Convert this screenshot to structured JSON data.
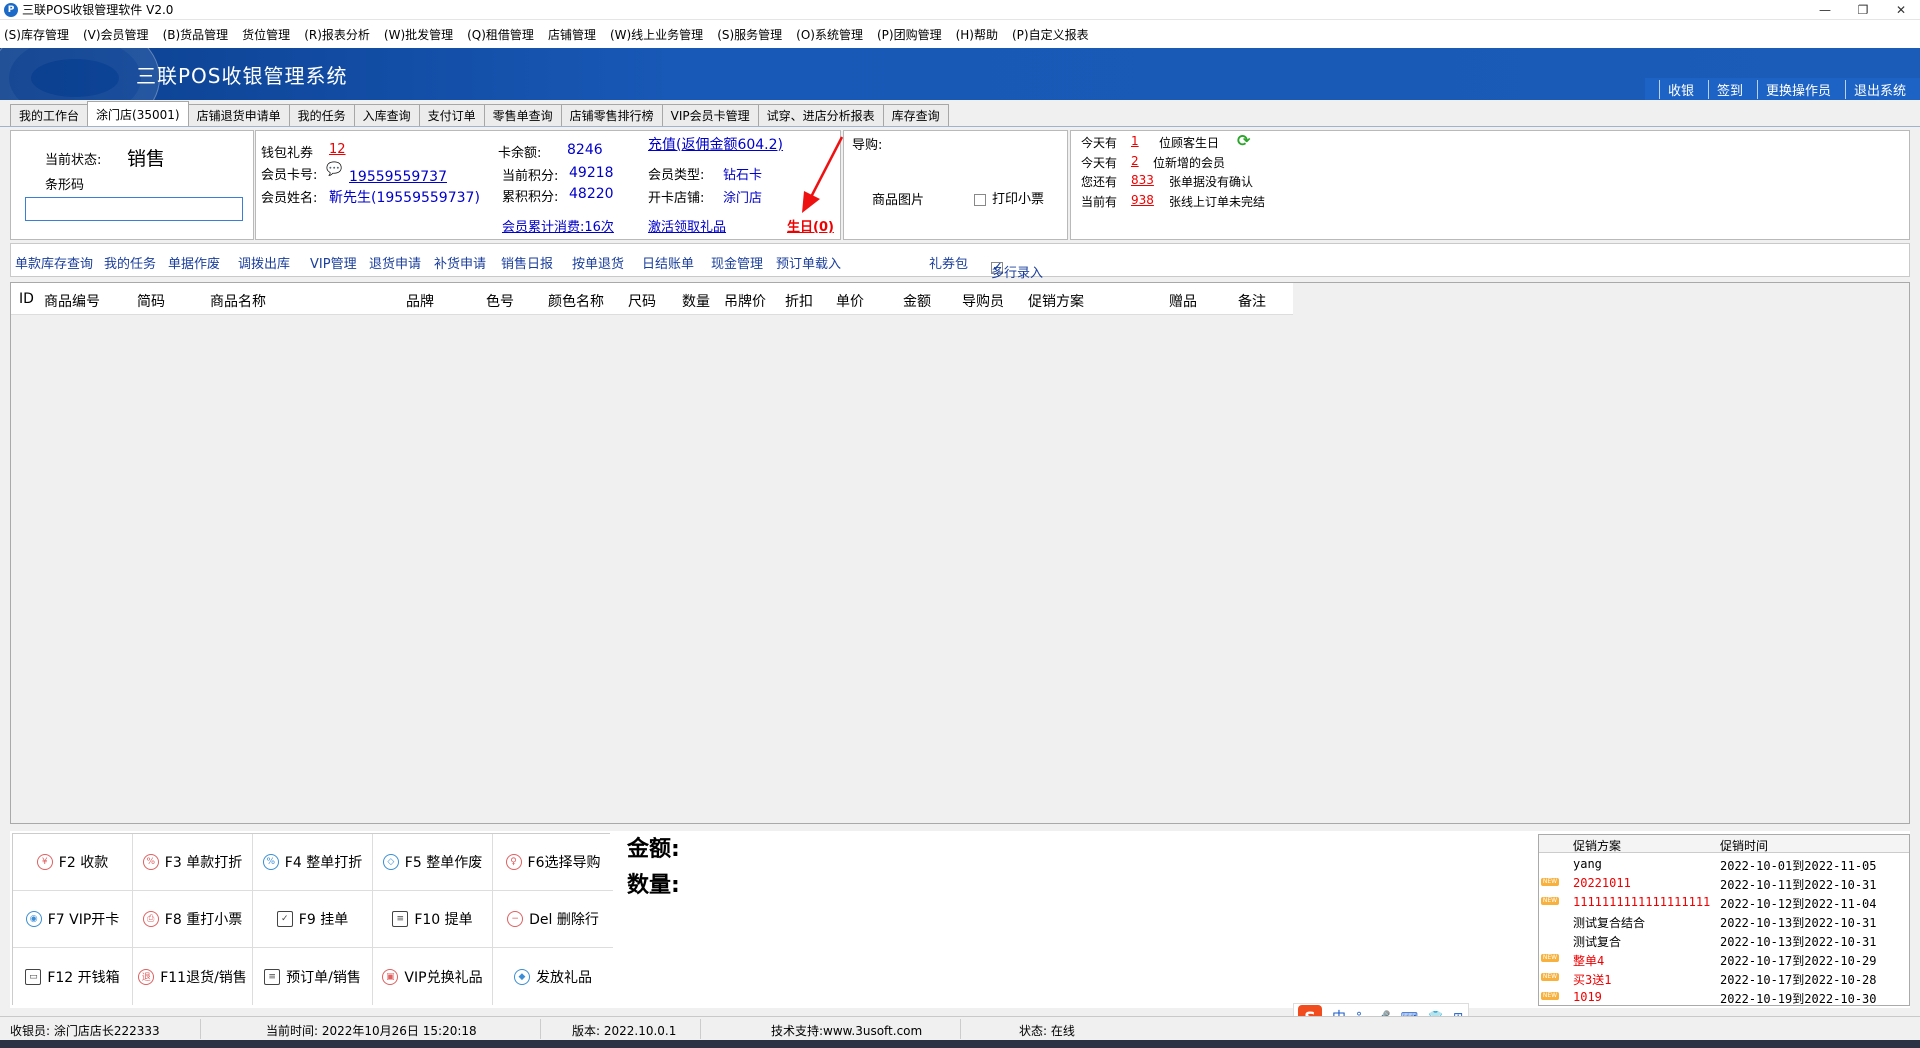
{
  "window": {
    "title": "三联POS收银管理软件 V2.0",
    "minimize": "—",
    "restore": "❐",
    "close": "✕"
  },
  "menu": [
    "(S)库存管理",
    "(V)会员管理",
    "(B)货品管理",
    "货位管理",
    "(R)报表分析",
    "(W)批发管理",
    "(Q)租借管理",
    "店铺管理",
    "(W)线上业务管理",
    "(S)服务管理",
    "(O)系统管理",
    "(P)团购管理",
    "(H)帮助",
    "(P)自定义报表"
  ],
  "banner": {
    "title": "三联POS收银管理系统",
    "actions": [
      "收银",
      "签到",
      "更换操作员",
      "退出系统"
    ]
  },
  "tabs": [
    "我的工作台",
    "涂门店(35001)",
    "店铺退货申请单",
    "我的任务",
    "入库查询",
    "支付订单",
    "零售单查询",
    "店铺零售排行榜",
    "VIP会员卡管理",
    "试穿、进店分析报表",
    "库存查询"
  ],
  "state": {
    "label": "当前状态:",
    "value": "销售",
    "barcode_label": "条形码",
    "barcode_value": ""
  },
  "member": {
    "wallet_label": "钱包礼券",
    "wallet_value": "12",
    "card_label": "会员卡号:",
    "card_value": "19559559737",
    "name_label": "会员姓名:",
    "name_value": "靳先生(19559559737)",
    "balance_label": "卡余额:",
    "balance_value": "8246",
    "points_label": "当前积分:",
    "points_value": "49218",
    "acc_points_label": "累积积分:",
    "acc_points_value": "48220",
    "recharge": "充值(返佣金额604.2)",
    "type_label": "会员类型:",
    "type_value": "钻石卡",
    "store_label": "开卡店铺:",
    "store_value": "涂门店",
    "consume": "会员累计消费:16次",
    "activate": "激活领取礼品",
    "birthday": "生日(0)"
  },
  "guide": {
    "label": "导购:",
    "image_label": "商品图片",
    "print_label": "打印小票"
  },
  "notice": [
    {
      "prefix": "今天有",
      "num": "1",
      "suffix": "位顾客生日"
    },
    {
      "prefix": "今天有",
      "num": "2",
      "suffix": "位新增的会员"
    },
    {
      "prefix": "您还有",
      "num": "833",
      "suffix": "张单据没有确认"
    },
    {
      "prefix": "当前有",
      "num": "938",
      "suffix": "张线上订单未完结"
    }
  ],
  "toolbar": [
    "单款库存查询",
    "我的任务",
    "单据作废",
    "调拨出库",
    "VIP管理",
    "退货申请",
    "补货申请",
    "销售日报",
    "按单退货",
    "日结账单",
    "现金管理",
    "预订单载入",
    "礼券包"
  ],
  "multi_entry": "多行录入",
  "columns": [
    "ID",
    "商品编号",
    "简码",
    "商品名称",
    "品牌",
    "色号",
    "颜色名称",
    "尺码",
    "数量",
    "吊牌价",
    "折扣",
    "单价",
    "金额",
    "导购员",
    "促销方案",
    "赠品",
    "备注"
  ],
  "fkeys": [
    {
      "label": "F2 收款",
      "icon": "¥"
    },
    {
      "label": "F3 单款打折",
      "icon": "%"
    },
    {
      "label": "F4 整单打折",
      "icon": "%"
    },
    {
      "label": "F5 整单作废",
      "icon": "◇"
    },
    {
      "label": "F6选择导购",
      "icon": "♀"
    },
    {
      "label": "F7 VIP开卡",
      "icon": "◉"
    },
    {
      "label": "F8 重打小票",
      "icon": "⎙"
    },
    {
      "label": "F9 挂单",
      "icon": "✓"
    },
    {
      "label": "F10 提单",
      "icon": "≡"
    },
    {
      "label": "Del 删除行",
      "icon": "−"
    },
    {
      "label": "F12 开钱箱",
      "icon": "▭"
    },
    {
      "label": "F11退货/销售",
      "icon": "退"
    },
    {
      "label": "预订单/销售",
      "icon": "≡"
    },
    {
      "label": "VIP兑换礼品",
      "icon": "▣"
    },
    {
      "label": "发放礼品",
      "icon": "◆"
    }
  ],
  "summary": {
    "amount_label": "金额:",
    "qty_label": "数量:"
  },
  "promo": {
    "headers": [
      "促销方案",
      "促销时间"
    ],
    "rows": [
      {
        "name": "yang",
        "time": "2022-10-01到2022-11-05",
        "new": false,
        "red": false
      },
      {
        "name": "20221011",
        "time": "2022-10-11到2022-10-31",
        "new": true,
        "red": true
      },
      {
        "name": "1111111111111111111",
        "time": "2022-10-12到2022-11-04",
        "new": true,
        "red": true
      },
      {
        "name": "测试复合结合",
        "time": "2022-10-13到2022-10-31",
        "new": false,
        "red": false
      },
      {
        "name": "测试复合",
        "time": "2022-10-13到2022-10-31",
        "new": false,
        "red": false
      },
      {
        "name": "整单4",
        "time": "2022-10-17到2022-10-29",
        "new": true,
        "red": true
      },
      {
        "name": "买3送1",
        "time": "2022-10-17到2022-10-28",
        "new": true,
        "red": true
      },
      {
        "name": "1019",
        "time": "2022-10-19到2022-10-30",
        "new": true,
        "red": true
      }
    ]
  },
  "status": {
    "cashier": "收银员: 涂门店店长222333",
    "time": "当前时间: 2022年10月26日 15:20:18",
    "version": "版本: 2022.10.0.1",
    "support": "技术支持:www.3usoft.com",
    "state": "状态: 在线"
  },
  "ime": {
    "logo": "S",
    "mode": "中",
    "punct": "°,",
    "mic": "🎤",
    "kb": "⌨",
    "skin": "👕",
    "apps": "⊞"
  }
}
